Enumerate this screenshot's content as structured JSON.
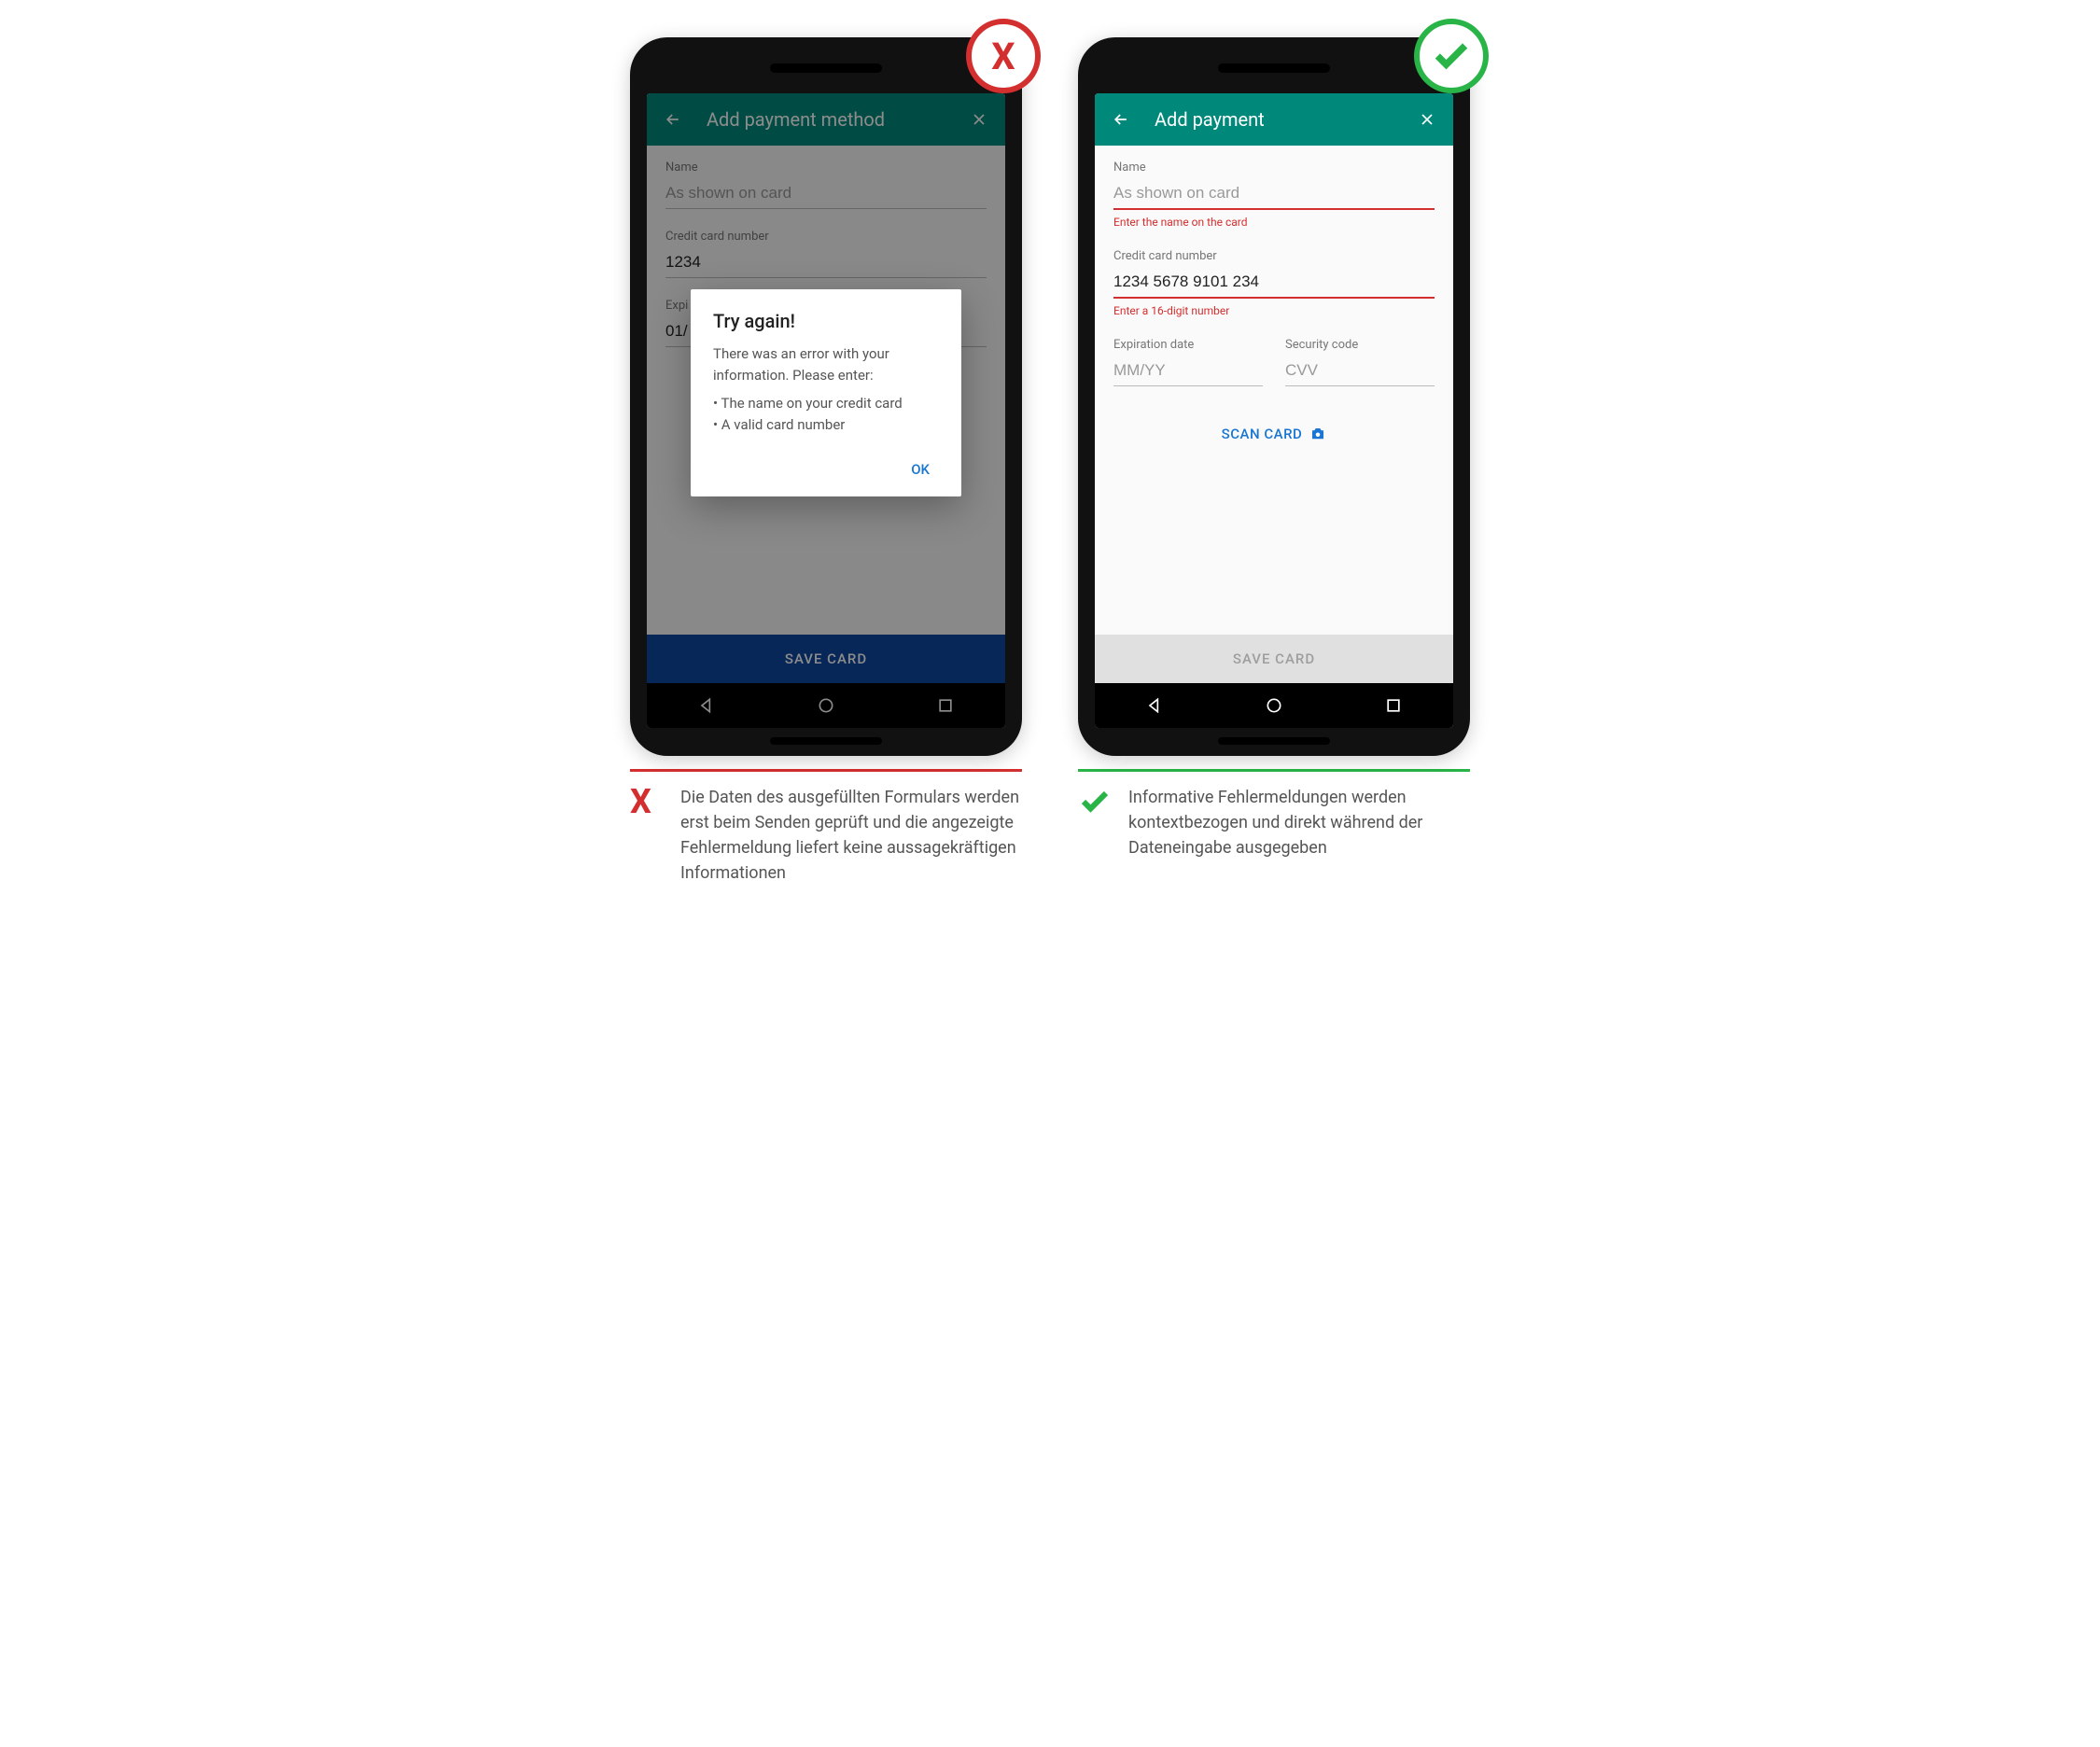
{
  "bad": {
    "appbar": {
      "title": "Add payment method"
    },
    "form": {
      "name_label": "Name",
      "name_placeholder": "As shown on card",
      "cc_label": "Credit card number",
      "cc_value": "1234",
      "exp_label": "Expi",
      "exp_value": "01/"
    },
    "dialog": {
      "title": "Try again!",
      "body_intro": "There was an error with your information. Please enter:",
      "bullet1": "The name on your credit card",
      "bullet2": "A valid card number",
      "ok": "OK"
    },
    "save_label": "SAVE CARD",
    "caption": "Die Daten des ausgefüllten Formulars werden erst beim Senden geprüft und die angezeigte Fehlermeldung liefert keine aussagekräftigen Informationen"
  },
  "good": {
    "appbar": {
      "title": "Add payment"
    },
    "form": {
      "name_label": "Name",
      "name_placeholder": "As shown on card",
      "name_error": "Enter the name on the card",
      "cc_label": "Credit card number",
      "cc_value": "1234 5678 9101 234",
      "cc_error": "Enter a 16-digit number",
      "exp_label": "Expiration date",
      "exp_placeholder": "MM/YY",
      "sec_label": "Security code",
      "sec_placeholder": "CVV",
      "scan_label": "SCAN CARD"
    },
    "save_label": "SAVE CARD",
    "caption": "Informative Fehlermeldungen werden kontextbezogen und direkt während der Dateneingabe ausgegeben"
  }
}
